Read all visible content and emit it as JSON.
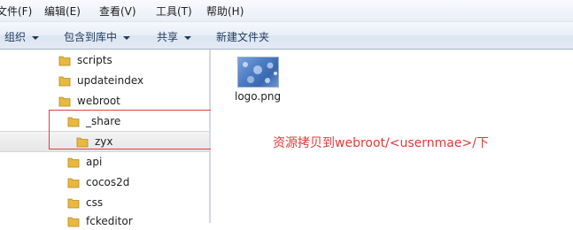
{
  "menubar": {
    "items": [
      "文件(F)",
      "编辑(E)",
      "查看(V)",
      "工具(T)",
      "帮助(H)"
    ]
  },
  "toolbar": {
    "organize": "组织",
    "include_in_library": "包含到库中",
    "share": "共享",
    "new_folder": "新建文件夹"
  },
  "tree": {
    "items": [
      {
        "label": "scripts"
      },
      {
        "label": "updateindex"
      },
      {
        "label": "webroot"
      },
      {
        "label": "_share"
      },
      {
        "label": "zyx"
      },
      {
        "label": "api"
      },
      {
        "label": "cocos2d"
      },
      {
        "label": "css"
      },
      {
        "label": "fckeditor"
      }
    ]
  },
  "content": {
    "file_name": "logo.png"
  },
  "annotation": {
    "text": "资源拷贝到webroot/<usernmae>/下",
    "color": "#e23a3a"
  },
  "colors": {
    "folder": "#e8b93c",
    "toolbar_text": "#1e3a5f"
  }
}
